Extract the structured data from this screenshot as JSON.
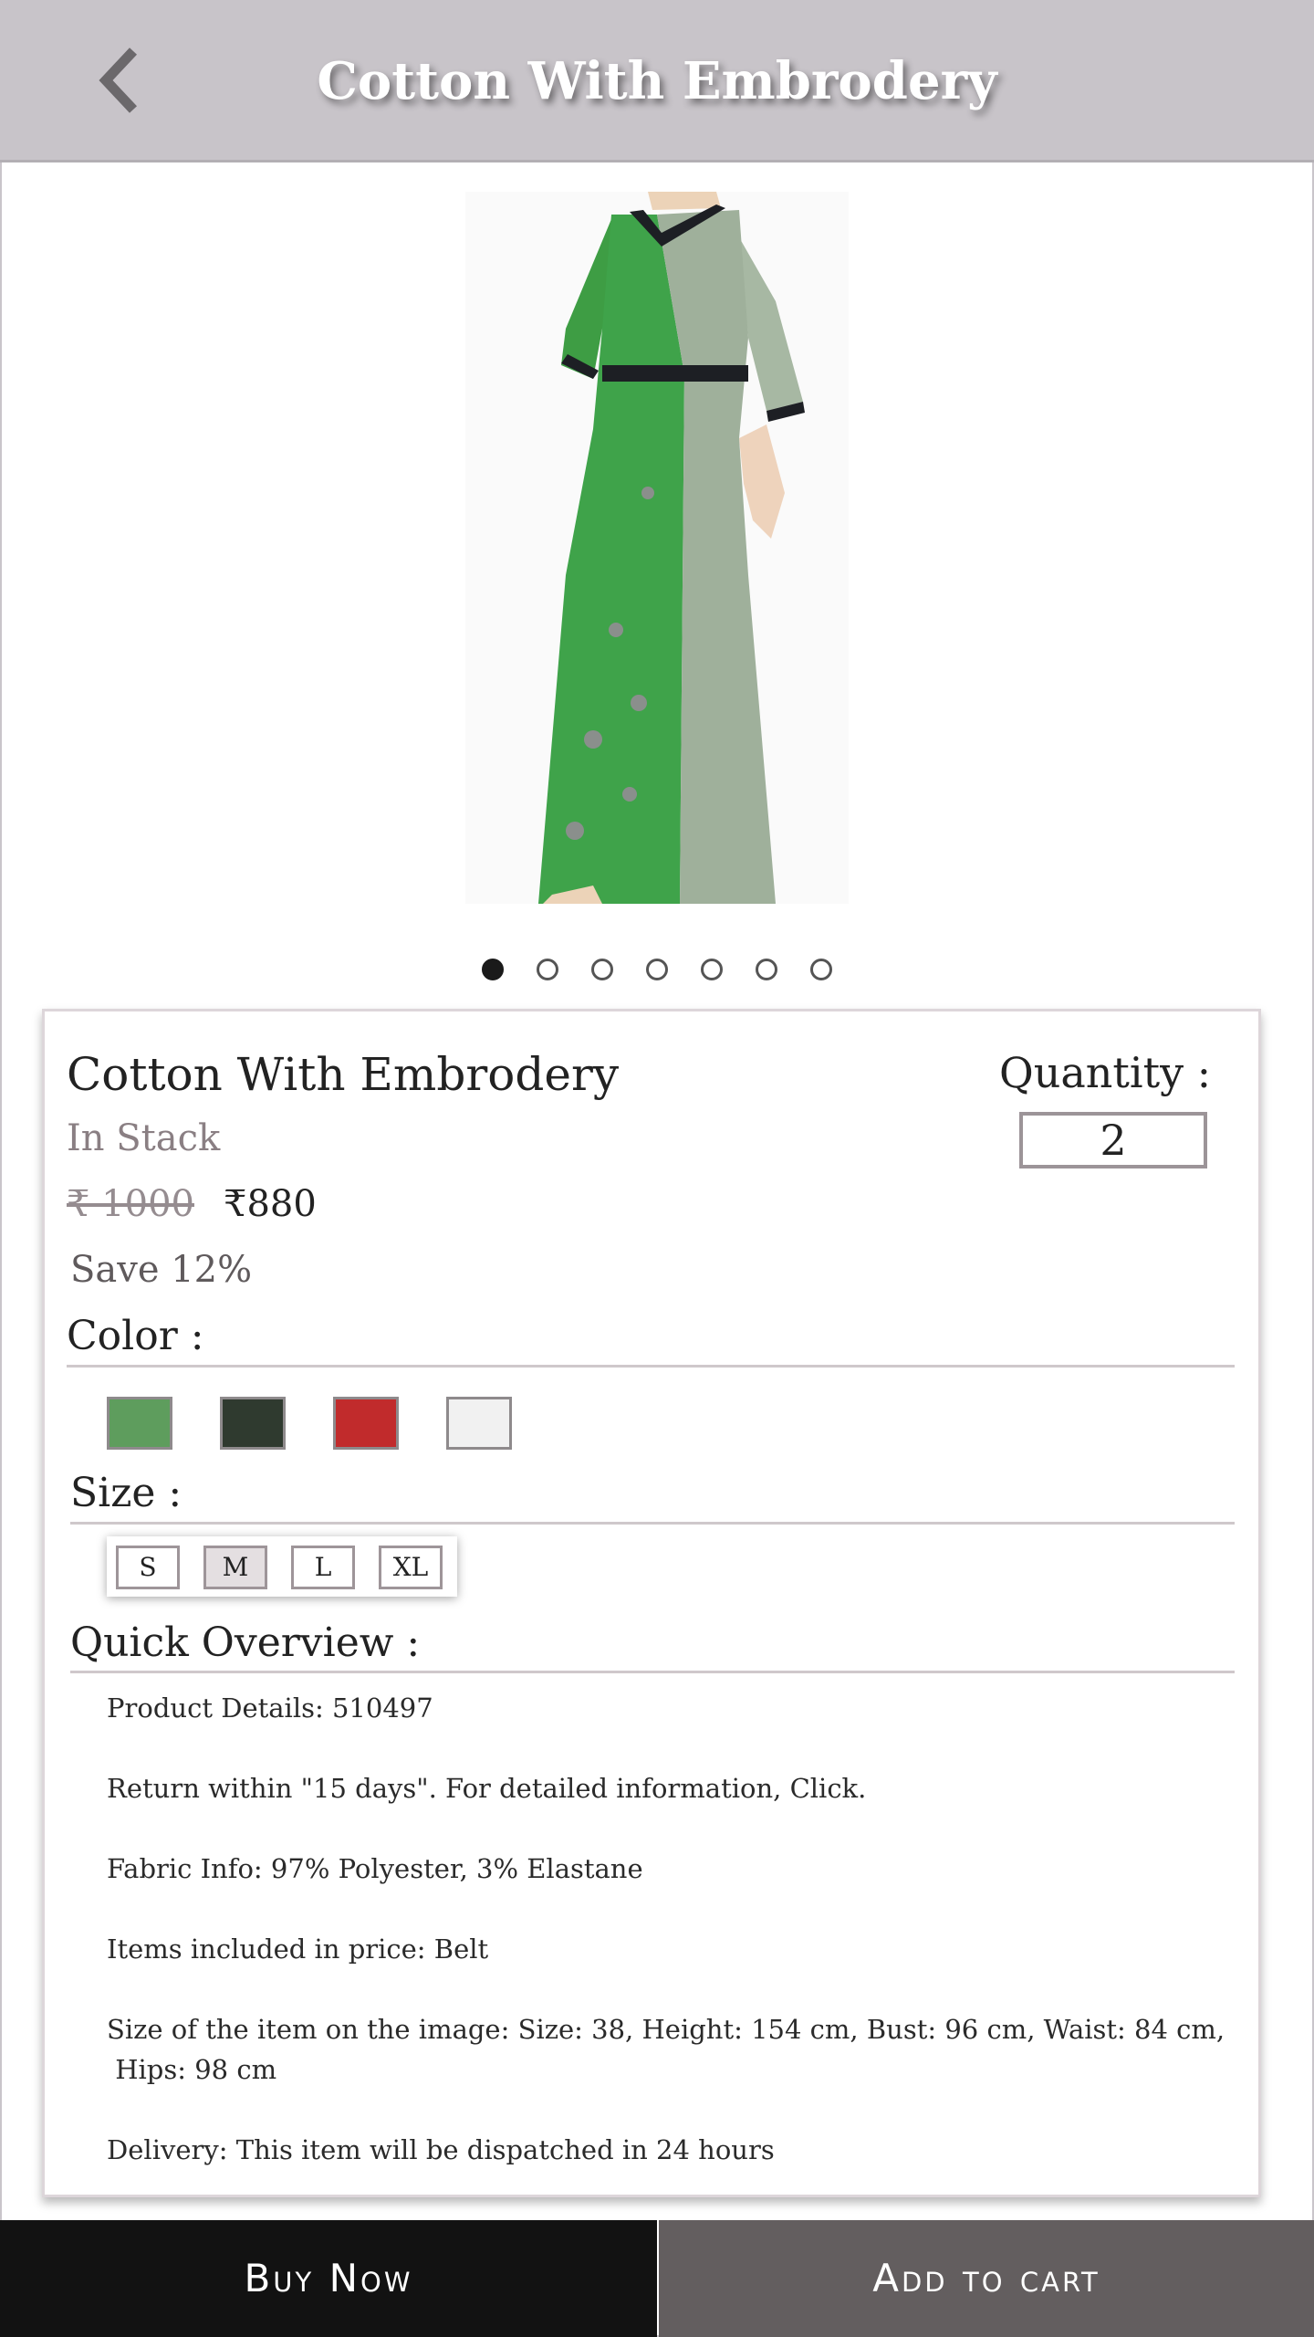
{
  "header": {
    "title": "Cotton With Embrodery",
    "back_icon": "chevron-left-icon"
  },
  "gallery": {
    "image_count": 7,
    "active_index": 0
  },
  "product": {
    "name": "Cotton With Embrodery",
    "stock_status": "In Stack",
    "original_price": "₹ 1000",
    "price": "₹880",
    "discount": "Save 12%",
    "quantity_label": "Quantity :",
    "quantity": "2"
  },
  "color": {
    "label": "Color :",
    "options": [
      "#5e9d5d",
      "#2f3a2f",
      "#c12b2c",
      "#f1f1f1"
    ]
  },
  "size": {
    "label": "Size :",
    "options": [
      "S",
      "M",
      "L",
      "XL"
    ],
    "selected": "M"
  },
  "overview": {
    "label": "Quick Overview :",
    "lines": [
      "Product Details: 510497",
      "Return within \"15 days\". For detailed information, Click.",
      "Fabric Info: 97% Polyester, 3% Elastane",
      "Items included in price: Belt",
      "Size of the item on the image: Size: 38, Height: 154 cm, Bust: 96 cm, Waist: 84 cm,",
      " Hips: 98 cm",
      "Delivery: This item will be dispatched in 24 hours"
    ]
  },
  "actions": {
    "buy_now": "Buy Now",
    "add_to_cart": "Add to cart"
  }
}
